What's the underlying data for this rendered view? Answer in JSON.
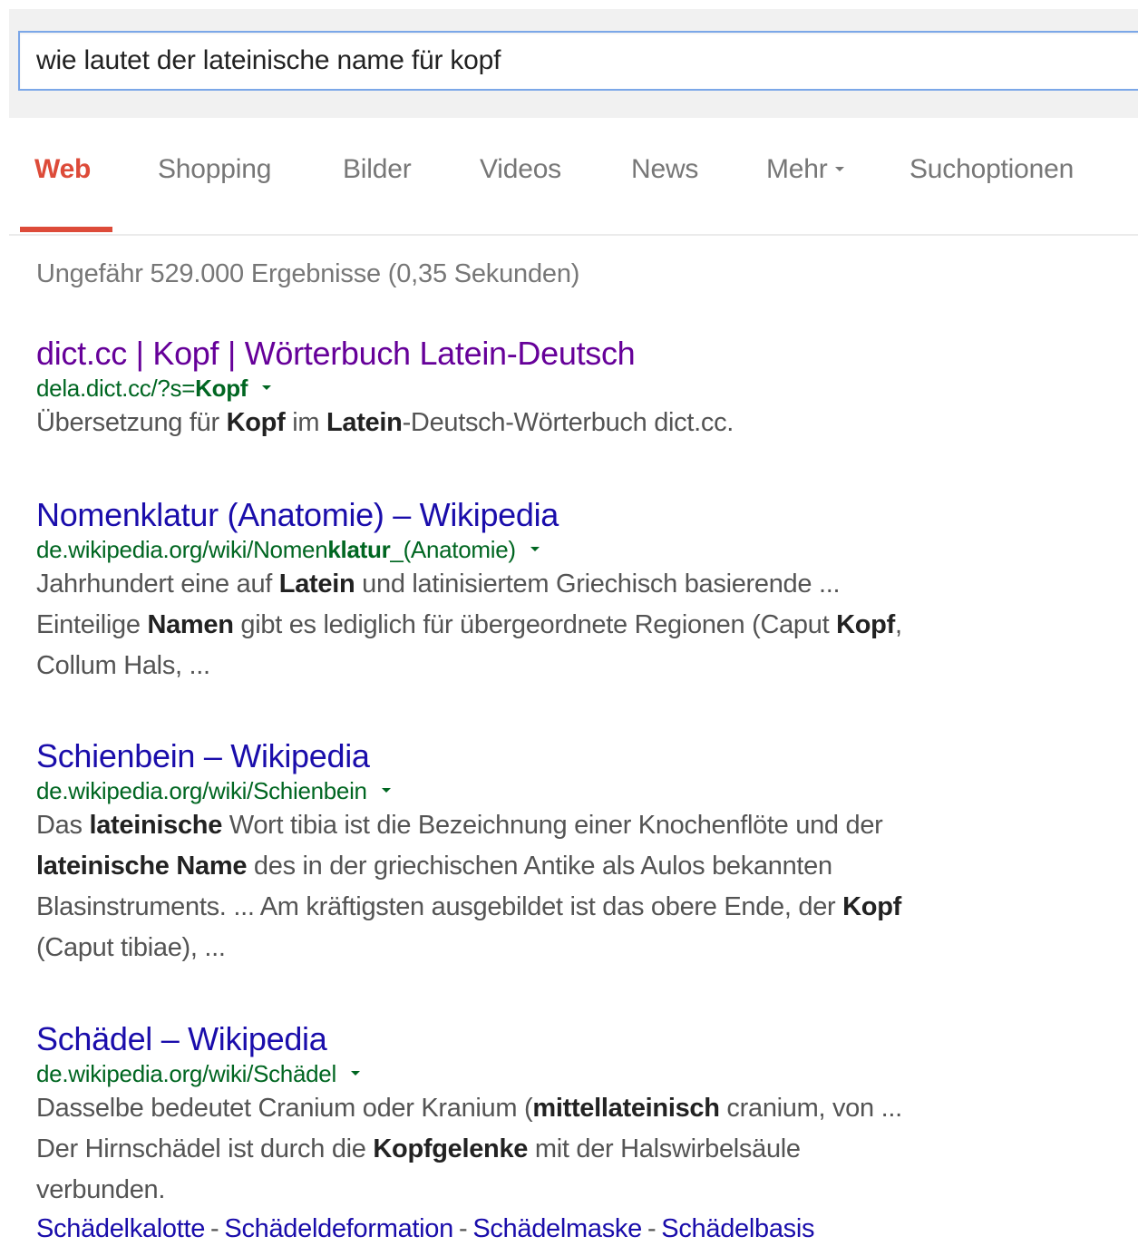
{
  "search": {
    "query": "wie lautet der lateinische name für kopf"
  },
  "tabs": [
    {
      "label": "Web",
      "active": true
    },
    {
      "label": "Shopping"
    },
    {
      "label": "Bilder"
    },
    {
      "label": "Videos"
    },
    {
      "label": "News"
    },
    {
      "label": "Mehr"
    },
    {
      "label": "Suchoptionen"
    }
  ],
  "stats": "Ungefähr 529.000 Ergebnisse (0,35 Sekunden)",
  "results": [
    {
      "title": "dict.cc | Kopf | Wörterbuch Latein-Deutsch",
      "visited": true,
      "url": [
        {
          "t": "dela.dict.cc/?s="
        },
        {
          "t": "Kopf",
          "b": true
        }
      ],
      "snippet": [
        [
          {
            "t": "Übersetzung für "
          },
          {
            "t": "Kopf",
            "b": true
          },
          {
            "t": " im "
          },
          {
            "t": "Latein",
            "b": true
          },
          {
            "t": "-Deutsch-Wörterbuch dict.cc."
          }
        ]
      ]
    },
    {
      "title": "Nomenklatur (Anatomie) – Wikipedia",
      "url": [
        {
          "t": "de.wikipedia.org/wiki/Nomen"
        },
        {
          "t": "klatur",
          "b": true
        },
        {
          "t": "_(Anatomie)"
        }
      ],
      "snippet": [
        [
          {
            "t": "Jahrhundert eine auf "
          },
          {
            "t": "Latein",
            "b": true
          },
          {
            "t": " und latinisiertem Griechisch basierende ..."
          }
        ],
        [
          {
            "t": "Einteilige "
          },
          {
            "t": "Namen",
            "b": true
          },
          {
            "t": " gibt es lediglich für übergeordnete Regionen (Caput "
          },
          {
            "t": "Kopf",
            "b": true
          },
          {
            "t": ","
          }
        ],
        [
          {
            "t": "Collum Hals, ..."
          }
        ]
      ]
    },
    {
      "title": "Schienbein – Wikipedia",
      "url": [
        {
          "t": "de.wikipedia.org/wiki/Schienbein"
        }
      ],
      "snippet": [
        [
          {
            "t": "Das "
          },
          {
            "t": "lateinische",
            "b": true
          },
          {
            "t": " Wort tibia ist die Bezeichnung einer Knochenflöte und der"
          }
        ],
        [
          {
            "t": "lateinische Name",
            "b": true
          },
          {
            "t": " des in der griechischen Antike als Aulos bekannten"
          }
        ],
        [
          {
            "t": "Blasinstruments. ... Am kräftigsten ausgebildet ist das obere Ende, der "
          },
          {
            "t": "Kopf",
            "b": true
          }
        ],
        [
          {
            "t": "(Caput tibiae), ..."
          }
        ]
      ]
    },
    {
      "title": "Schädel – Wikipedia",
      "url": [
        {
          "t": "de.wikipedia.org/wiki/Schädel"
        }
      ],
      "snippet": [
        [
          {
            "t": "Dasselbe bedeutet Cranium oder Kranium ("
          },
          {
            "t": "mittellateinisch",
            "b": true
          },
          {
            "t": " cranium, von ..."
          }
        ],
        [
          {
            "t": "Der Hirnschädel ist durch die "
          },
          {
            "t": "Kopfgelenke",
            "b": true
          },
          {
            "t": " mit der Halswirbelsäule"
          }
        ],
        [
          {
            "t": "verbunden."
          }
        ]
      ],
      "sitelinks": [
        "Schädelkalotte",
        "Schädeldeformation",
        "Schädelmaske",
        "Schädelbasis"
      ]
    }
  ]
}
